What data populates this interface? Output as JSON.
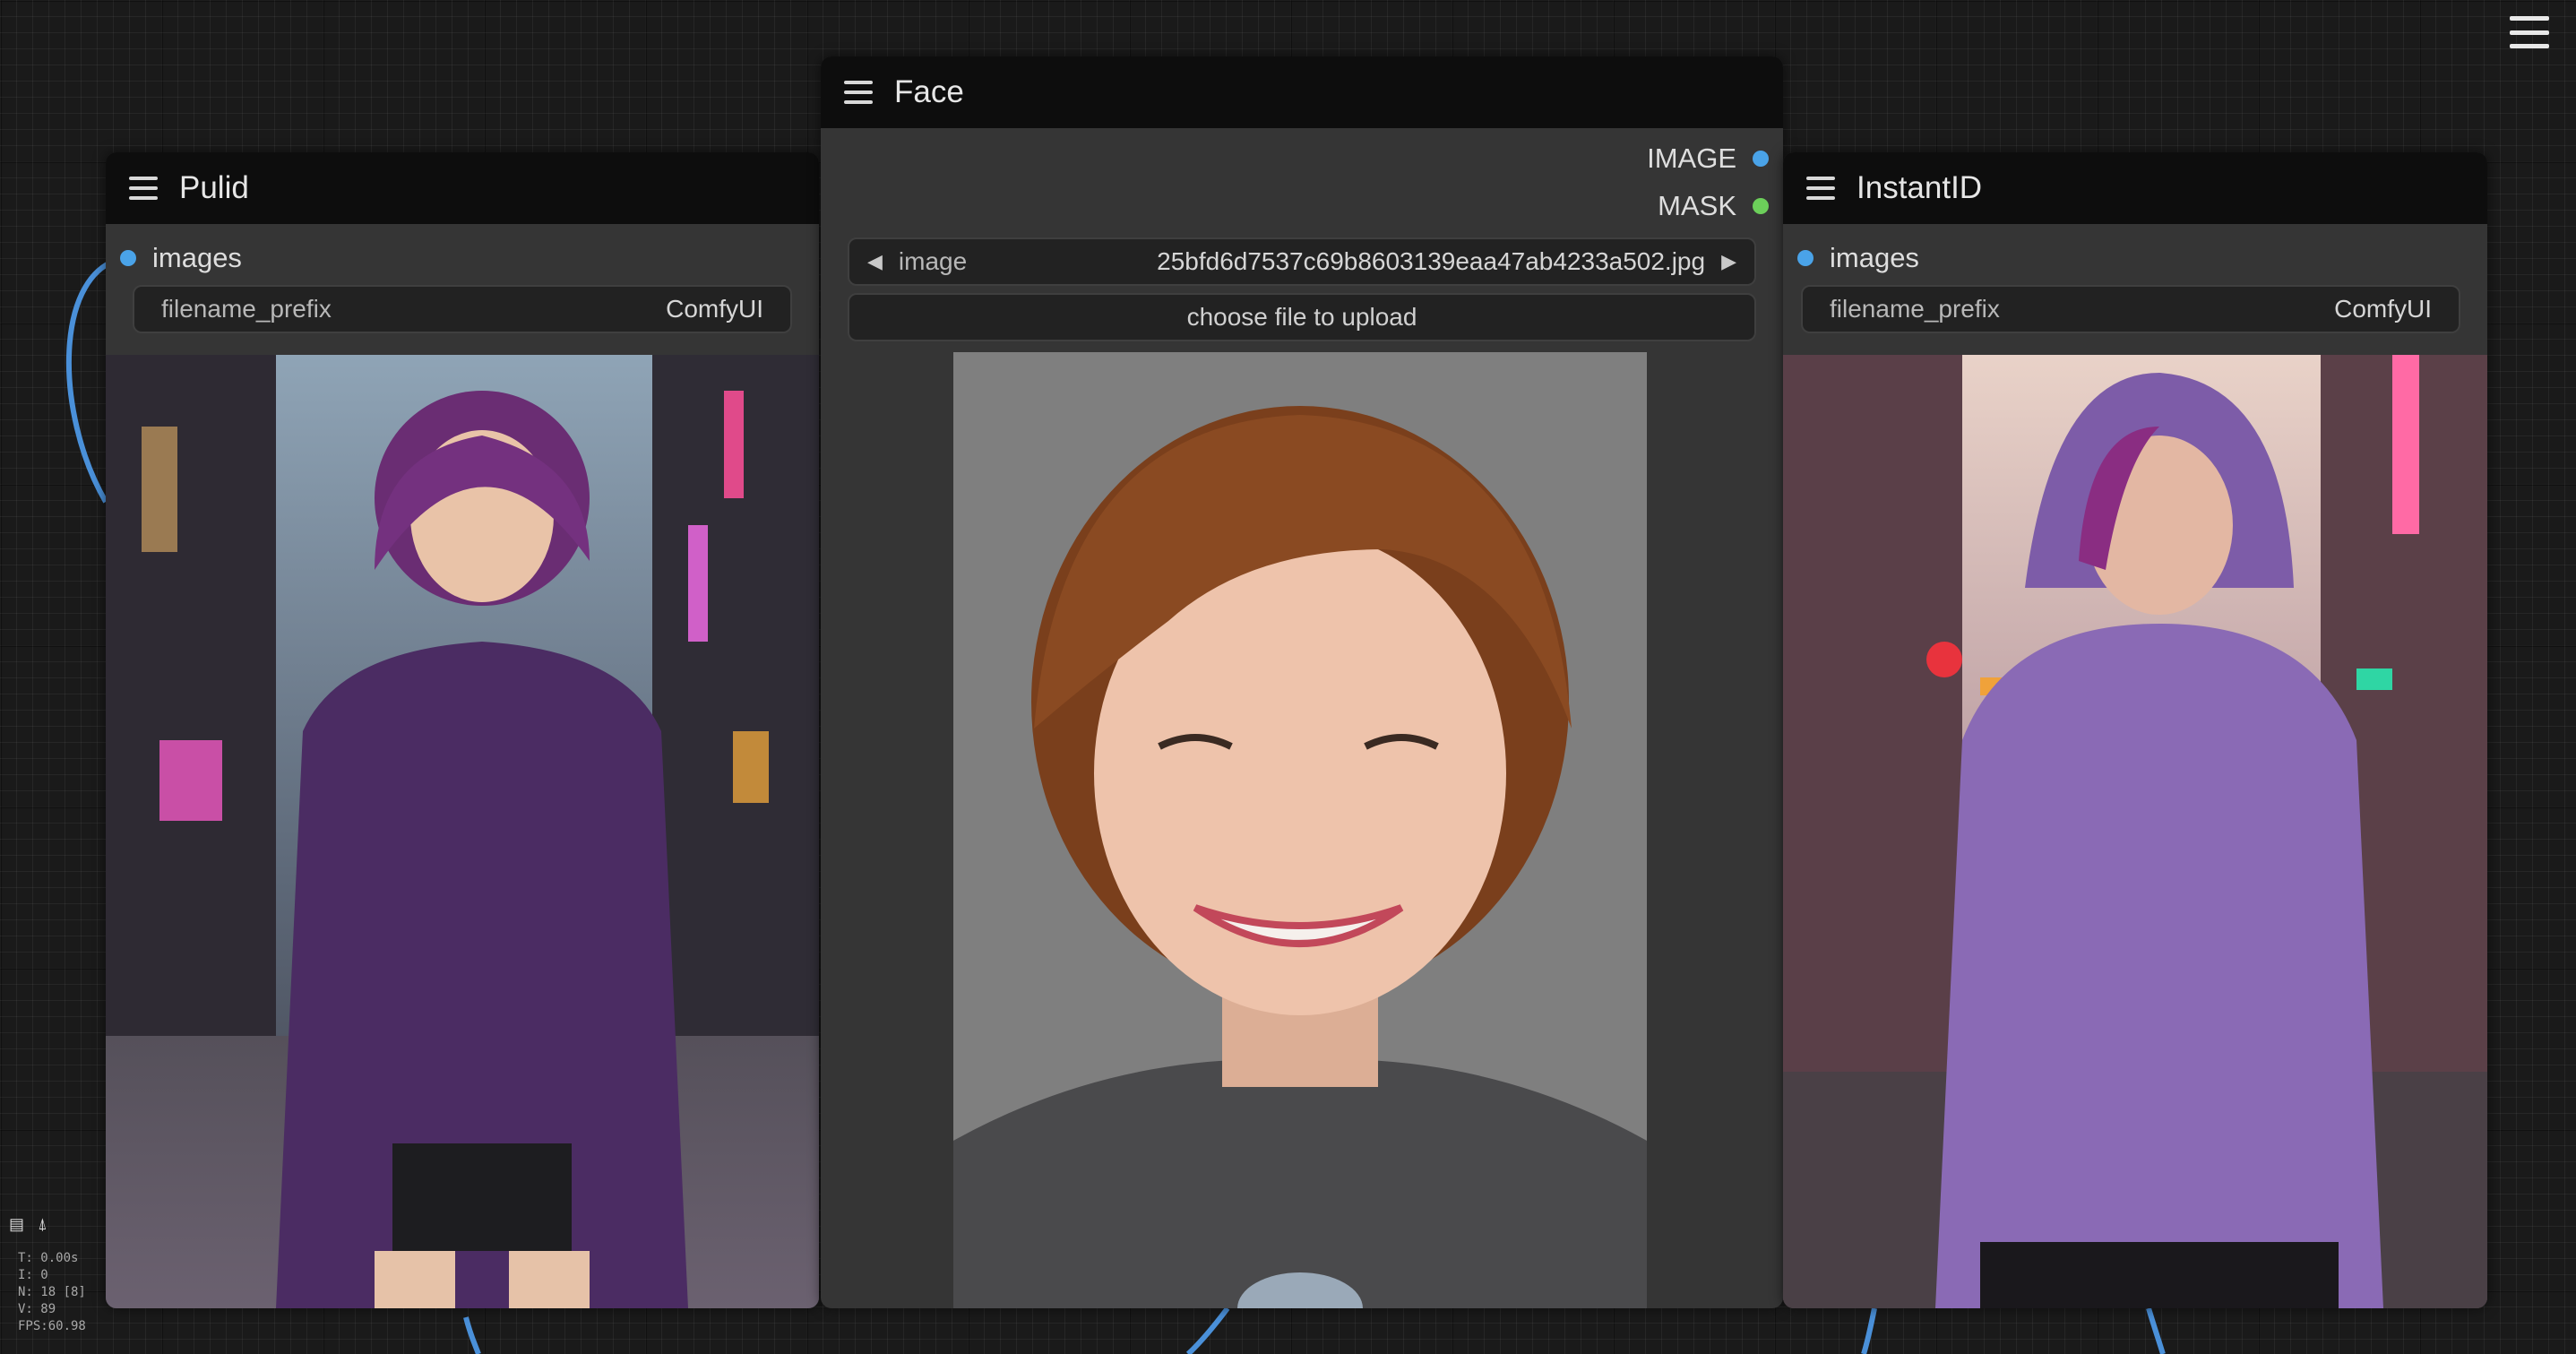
{
  "colors": {
    "image_slot": "#4aa3e8",
    "mask_slot": "#6ccf5a",
    "link": "#4a90d9"
  },
  "nodes": {
    "pulid": {
      "title": "Pulid",
      "input_label": "images",
      "widget_label": "filename_prefix",
      "widget_value": "ComfyUI",
      "image": "portrait of woman with purple bob hair in purple hoodie on neon-lit rainy street"
    },
    "face": {
      "title": "Face",
      "output_image_label": "IMAGE",
      "output_mask_label": "MASK",
      "combo_label": "image",
      "combo_value": "25bfd6d7537c69b8603139eaa47ab4233a502.jpg",
      "upload_label": "choose file to upload",
      "image": "close-up headshot of smiling woman with brown bob haircut, grey sweater, grey background"
    },
    "instantid": {
      "title": "InstantID",
      "input_label": "images",
      "widget_label": "filename_prefix",
      "widget_value": "ComfyUI",
      "image": "portrait of woman with purple hair in lavender hoodie on city street at dusk"
    }
  },
  "stats": {
    "lines": [
      "T: 0.00s",
      "I: 0",
      "N: 18 [8]",
      "V: 89",
      "FPS:60.98"
    ]
  },
  "icons": {
    "main_menu": "hamburger-menu-icon",
    "stats_a": "document-icon",
    "stats_b": "pin-icon"
  }
}
